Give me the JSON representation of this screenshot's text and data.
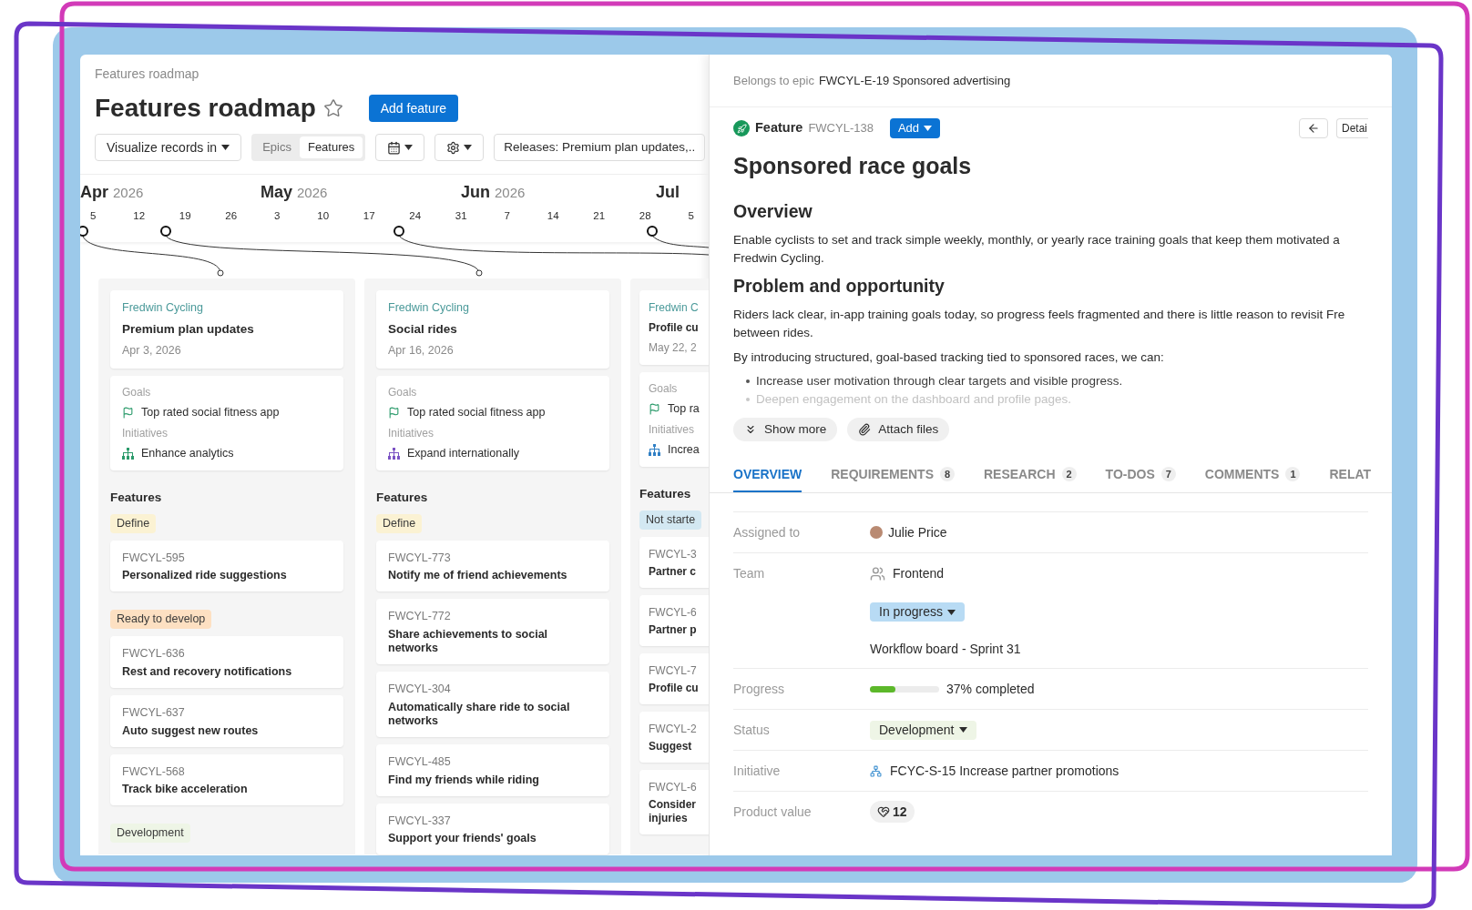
{
  "breadcrumb": "Features roadmap",
  "title": "Features roadmap",
  "add_button": "Add feature",
  "toolbar": {
    "visualize": "Visualize records in",
    "segments": [
      {
        "label": "Epics",
        "selected": false
      },
      {
        "label": "Features",
        "selected": true
      }
    ],
    "releases": "Releases: Premium plan updates,.."
  },
  "timeline": {
    "months": [
      {
        "name": "Apr",
        "year": "2026"
      },
      {
        "name": "May",
        "year": "2026"
      },
      {
        "name": "Jun",
        "year": "2026"
      },
      {
        "name": "Jul"
      }
    ],
    "weeks": [
      "5",
      "12",
      "19",
      "26",
      "3",
      "10",
      "17",
      "24",
      "31",
      "7",
      "14",
      "21",
      "28",
      "5"
    ]
  },
  "columns": [
    {
      "product": "Fredwin Cycling",
      "release": "Premium plan updates",
      "date": "Apr 3, 2026",
      "goals_label": "Goals",
      "goal": "Top rated social fitness app",
      "initiatives_label": "Initiatives",
      "initiative": {
        "name": "Enhance analytics",
        "color": "#2a9a6a"
      },
      "features_label": "Features",
      "groups": [
        {
          "status": "Define",
          "color": "#fbf2d3",
          "features": [
            {
              "id": "FWCYL-595",
              "name": "Personalized ride suggestions"
            }
          ]
        },
        {
          "status": "Ready to develop",
          "color": "#fde0c2",
          "features": [
            {
              "id": "FWCYL-636",
              "name": "Rest and recovery notifications"
            },
            {
              "id": "FWCYL-637",
              "name": "Auto suggest new routes"
            },
            {
              "id": "FWCYL-568",
              "name": "Track bike acceleration"
            }
          ]
        },
        {
          "status": "Development",
          "color": "#eef5e6"
        }
      ]
    },
    {
      "product": "Fredwin Cycling",
      "release": "Social rides",
      "date": "Apr 16, 2026",
      "goals_label": "Goals",
      "goal": "Top rated social fitness app",
      "initiatives_label": "Initiatives",
      "initiative": {
        "name": "Expand internationally",
        "color": "#7b52c4"
      },
      "features_label": "Features",
      "groups": [
        {
          "status": "Define",
          "color": "#fbf2d3",
          "features": [
            {
              "id": "FWCYL-773",
              "name": "Notify me of friend achievements"
            },
            {
              "id": "FWCYL-772",
              "name": "Share achievements to social networks"
            },
            {
              "id": "FWCYL-304",
              "name": "Automatically share ride to social networks"
            },
            {
              "id": "FWCYL-485",
              "name": "Find my friends while riding"
            },
            {
              "id": "FWCYL-337",
              "name": "Support your friends' goals"
            }
          ]
        }
      ]
    },
    {
      "product": "Fredwin C",
      "release": "Profile cu",
      "date": "May 22, 2",
      "goals_label": "Goals",
      "goal": "Top ra",
      "initiatives_label": "Initiatives",
      "initiative": {
        "name": "Increa",
        "color": "#2f7fc4"
      },
      "features_label": "Features",
      "groups": [
        {
          "status": "Not starte",
          "color": "#d3e8f2",
          "features": [
            {
              "id": "FWCYL-3",
              "name": "Partner c"
            },
            {
              "id": "FWCYL-6",
              "name": "Partner p"
            },
            {
              "id": "FWCYL-7",
              "name": "Profile cu"
            },
            {
              "id": "FWCYL-2",
              "name": "Suggest"
            },
            {
              "id": "FWCYL-6",
              "name": "Consider injuries"
            }
          ]
        }
      ]
    }
  ],
  "detail": {
    "epic_prefix": "Belongs to epic",
    "epic": "FWCYL-E-19 Sponsored advertising",
    "record_type": "Feature",
    "record_id": "FWCYL-138",
    "add": "Add",
    "details": "Detai",
    "title": "Sponsored race goals",
    "sections": [
      {
        "heading": "Overview",
        "paragraphs": [
          [
            "Enable cyclists to set and track simple weekly, monthly, or yearly race training goals that keep them motivated a",
            "Fredwin Cycling."
          ]
        ]
      },
      {
        "heading": "Problem and opportunity",
        "paragraphs": [
          [
            "Riders lack clear, in-app training goals today, so progress feels fragmented and there is little reason to revisit Fre",
            "between rides."
          ],
          [
            "By introducing structured, goal-based tracking tied to sponsored races, we can:"
          ]
        ]
      }
    ],
    "bullets": [
      {
        "text": "Increase user motivation through clear targets and visible progress.",
        "faded": false
      },
      {
        "text": "Deepen engagement on the dashboard and profile pages.",
        "faded": true
      }
    ],
    "show_more": "Show more",
    "attach": "Attach files",
    "tabs": [
      {
        "label": "OVERVIEW",
        "selected": true
      },
      {
        "label": "REQUIREMENTS",
        "count": "8",
        "selected": false
      },
      {
        "label": "RESEARCH",
        "count": "2",
        "selected": false
      },
      {
        "label": "TO-DOS",
        "count": "7",
        "selected": false
      },
      {
        "label": "COMMENTS",
        "count": "1",
        "selected": false
      },
      {
        "label": "RELAT",
        "selected": false
      }
    ],
    "fields": [
      {
        "kind": "person",
        "label": "Assigned to",
        "value": "Julie Price"
      },
      {
        "kind": "team",
        "label": "Team",
        "value": "Frontend"
      },
      {
        "kind": "dropdown",
        "value": "In progress",
        "color": "#b8dbf4"
      },
      {
        "kind": "text",
        "value": "Workflow board - Sprint 31"
      },
      {
        "kind": "progress",
        "label": "Progress",
        "level": 0.37,
        "value": "37% completed"
      },
      {
        "kind": "dropdown",
        "label": "Status",
        "value": "Development",
        "color": "#eef5e6"
      },
      {
        "kind": "initiative",
        "label": "Initiative",
        "value": "FCYC-S-15 Increase partner promotions"
      },
      {
        "kind": "score",
        "label": "Product value",
        "value": "12"
      }
    ]
  }
}
